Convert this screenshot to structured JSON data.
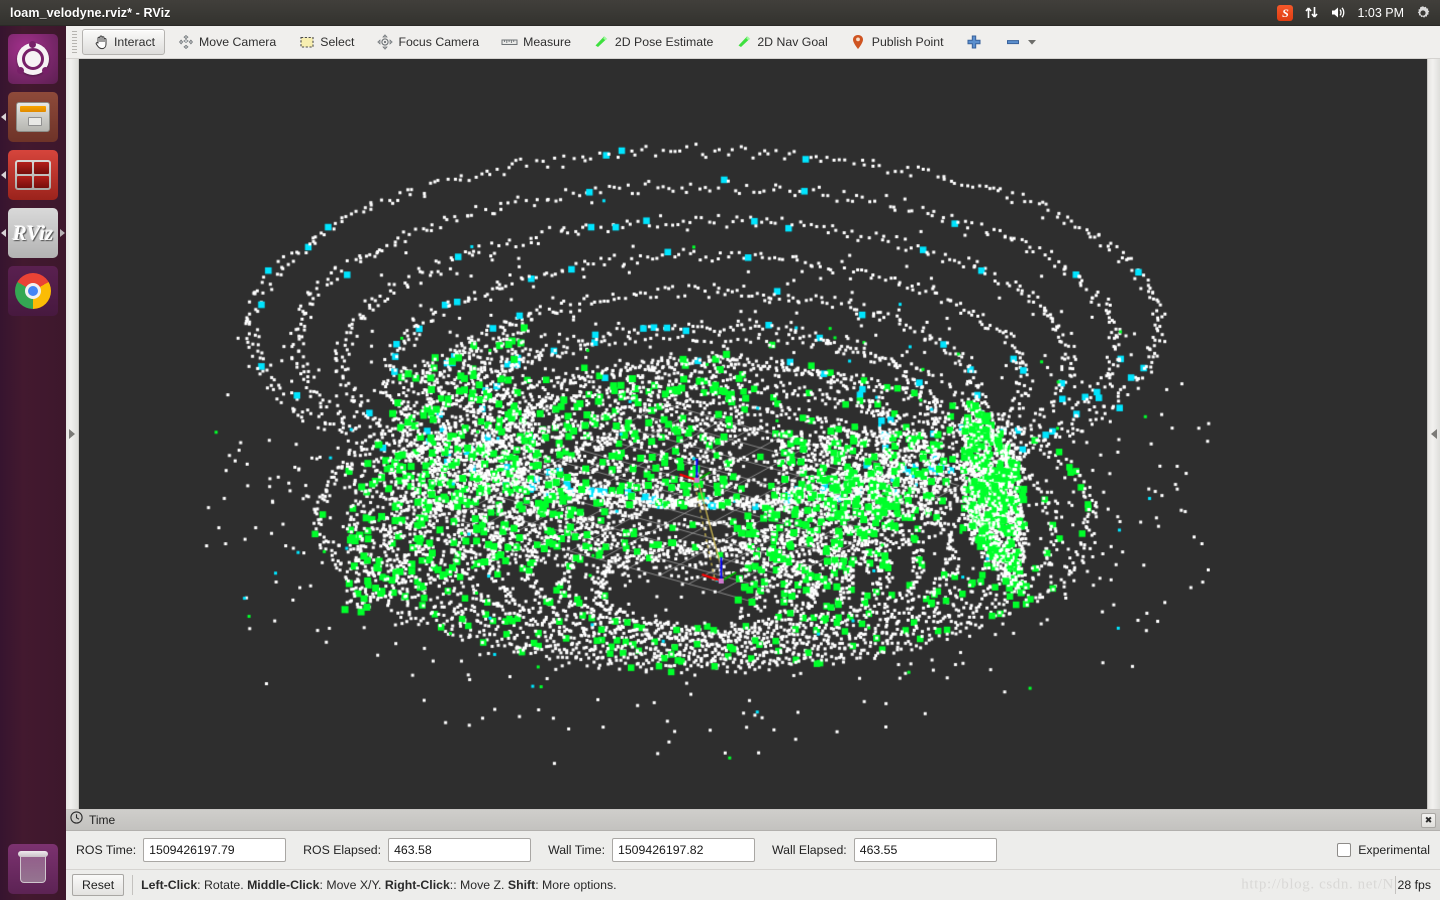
{
  "window": {
    "title": "loam_velodyne.rviz* - RViz"
  },
  "tray": {
    "input_method_icon": "sogou-input-icon",
    "input_method_label": "S",
    "network_icon": "network-updown-icon",
    "volume_icon": "volume-icon",
    "clock": "1:03 PM",
    "settings_icon": "gear-icon"
  },
  "launcher": {
    "items": [
      {
        "name": "dash-home",
        "label": "Ubuntu Dash"
      },
      {
        "name": "files",
        "label": "Files"
      },
      {
        "name": "red-app",
        "label": "Application"
      },
      {
        "name": "rviz",
        "label": "RViz"
      },
      {
        "name": "chrome",
        "label": "Google Chrome"
      }
    ],
    "trash_label": "Trash"
  },
  "toolbar": {
    "buttons": [
      {
        "label": "Interact",
        "icon": "hand-cursor-icon",
        "active": true
      },
      {
        "label": "Move Camera",
        "icon": "move-camera-icon",
        "active": false
      },
      {
        "label": "Select",
        "icon": "selection-box-icon",
        "active": false
      },
      {
        "label": "Focus Camera",
        "icon": "focus-camera-icon",
        "active": false
      },
      {
        "label": "Measure",
        "icon": "ruler-icon",
        "active": false
      },
      {
        "label": "2D Pose Estimate",
        "icon": "green-arrow-icon",
        "active": false
      },
      {
        "label": "2D Nav Goal",
        "icon": "green-arrow-icon",
        "active": false
      },
      {
        "label": "Publish Point",
        "icon": "map-marker-icon",
        "active": false
      }
    ],
    "add_tool_icon": "plus-icon",
    "remove_tool_icon": "minus-icon",
    "remove_tool_dropdown_icon": "chevron-down-icon"
  },
  "panels": {
    "left_handle_icon": "expand-right-triangle-icon",
    "right_handle_icon": "expand-left-triangle-icon"
  },
  "time_panel": {
    "title": "Time",
    "title_icon": "clock-icon",
    "close_icon": "close-icon",
    "fields": [
      {
        "label": "ROS Time:",
        "value": "1509426197.79"
      },
      {
        "label": "ROS Elapsed:",
        "value": "463.58"
      },
      {
        "label": "Wall Time:",
        "value": "1509426197.82"
      },
      {
        "label": "Wall Elapsed:",
        "value": "463.55"
      }
    ],
    "experimental_label": "Experimental",
    "experimental_checked": false
  },
  "statusbar": {
    "reset_label": "Reset",
    "help": {
      "k1": "Left-Click",
      "t1": ": Rotate. ",
      "k2": "Middle-Click",
      "t2": ": Move X/Y. ",
      "k3": "Right-Click",
      "t3": ":: Move Z. ",
      "k4": "Shift",
      "t4": ": More options."
    },
    "fps": "28 fps",
    "watermark": "http://blog. csdn. net/N"
  },
  "viewport": {
    "background_color": "#2e2e2e",
    "grid_color": "#a0a0a0",
    "point_colors": {
      "surface": "#ffffff",
      "edge_near": "#00ff2a",
      "edge_far": "#00e5ff",
      "trajectory": "#c8b450"
    },
    "grid_cells": 10,
    "axes": [
      {
        "name": "origin-axes",
        "x_color": "#ff0000",
        "y_color": "#00aa00",
        "z_color": "#0000ff"
      },
      {
        "name": "current-pose-axes",
        "x_color": "#ff0000",
        "y_color": "#00aa00",
        "z_color": "#0000ff"
      }
    ]
  }
}
